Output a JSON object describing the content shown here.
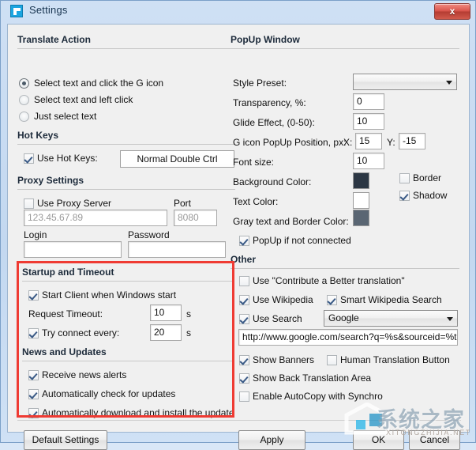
{
  "window": {
    "title": "Settings",
    "icon": "app-icon",
    "close_label": "x"
  },
  "left": {
    "translate_action": {
      "title": "Translate Action",
      "options": [
        {
          "label": "Select text and click the G icon",
          "selected": true
        },
        {
          "label": "Select text and left click",
          "selected": false
        },
        {
          "label": "Just select text",
          "selected": false
        }
      ]
    },
    "hot_keys": {
      "title": "Hot Keys",
      "use_label": "Use Hot Keys:",
      "use_checked": true,
      "hotkey_value": "Normal Double Ctrl"
    },
    "proxy": {
      "title": "Proxy Settings",
      "use_label": "Use Proxy Server",
      "use_checked": false,
      "port_label": "Port",
      "server_placeholder": "123.45.67.89",
      "port_placeholder": "8080",
      "login_label": "Login",
      "password_label": "Password",
      "login_value": "",
      "password_value": ""
    },
    "startup": {
      "title": "Startup and Timeout",
      "start_client_label": "Start Client when Windows start",
      "start_client_checked": true,
      "request_timeout_label": "Request Timeout:",
      "request_timeout_value": "10",
      "request_timeout_unit": "s",
      "try_connect_label": "Try connect every:",
      "try_connect_checked": true,
      "try_connect_value": "20",
      "try_connect_unit": "s"
    },
    "news": {
      "title": "News and Updates",
      "items": [
        {
          "label": "Receive news alerts",
          "checked": true
        },
        {
          "label": "Automatically check for updates",
          "checked": true
        },
        {
          "label": "Automatically download and install the update",
          "checked": true
        }
      ]
    }
  },
  "right": {
    "popup": {
      "title": "PopUp Window",
      "style_preset_label": "Style Preset:",
      "style_preset_value": "",
      "transparency_label": "Transparency, %:",
      "transparency_value": "0",
      "glide_label": "Glide Effect, (0-50):",
      "glide_value": "10",
      "position_label": "G icon PopUp Position, px:",
      "pos_x_label": "X:",
      "pos_x_value": "15",
      "pos_y_label": "Y:",
      "pos_y_value": "-15",
      "font_size_label": "Font size:",
      "font_size_value": "10",
      "background_color_label": "Background Color:",
      "background_color": "#2c3744",
      "text_color_label": "Text Color:",
      "text_color": "#ffffff",
      "gray_color_label": "Gray text and Border Color:",
      "gray_color": "#5a6673",
      "border_label": "Border",
      "border_checked": false,
      "shadow_label": "Shadow",
      "shadow_checked": true,
      "popup_not_connected_label": "PopUp if not connected",
      "popup_not_connected_checked": true
    },
    "other": {
      "title": "Other",
      "contribute_label": "Use \"Contribute a Better translation\"",
      "contribute_checked": false,
      "use_wikipedia_label": "Use Wikipedia",
      "use_wikipedia_checked": true,
      "smart_wikipedia_label": "Smart Wikipedia Search",
      "smart_wikipedia_checked": true,
      "use_search_label": "Use Search",
      "use_search_checked": true,
      "search_engine_value": "Google",
      "search_url_value": "http://www.google.com/search?q=%s&sourceid=%tc&ie",
      "show_banners_label": "Show Banners",
      "show_banners_checked": true,
      "human_translation_label": "Human Translation Button",
      "human_translation_checked": false,
      "show_back_translation_label": "Show Back Translation Area",
      "show_back_translation_checked": true,
      "enable_autocopy_label": "Enable AutoCopy with Synchro",
      "enable_autocopy_checked": false
    }
  },
  "footer": {
    "default_settings_label": "Default Settings",
    "apply_label": "Apply",
    "ok_label": "OK",
    "cancel_label": "Cancel"
  },
  "watermark": {
    "text": "系统之家",
    "domain": "XITONGZHIJIA.NET"
  }
}
